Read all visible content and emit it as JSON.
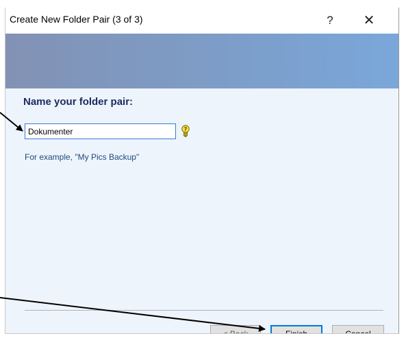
{
  "window": {
    "title": "Create New Folder Pair (3 of 3)",
    "help_label": "?",
    "close_label": "✕"
  },
  "page": {
    "heading": "Name your folder pair:",
    "folder_pair_name": "Dokumenter",
    "example_text": "For example, \"My Pics Backup\""
  },
  "buttons": {
    "back_label": "< Back",
    "finish_label": "Finish",
    "cancel_label": "Cancel"
  },
  "colors": {
    "banner_left": "#8292b4",
    "banner_right": "#7aa7da",
    "content_background": "#eef4fb",
    "heading_color": "#1c2a5f",
    "focus_border": "#0078d7"
  },
  "icons": {
    "hint": "lightbulb-help-icon",
    "annotation_arrows": "arrow-icon"
  }
}
